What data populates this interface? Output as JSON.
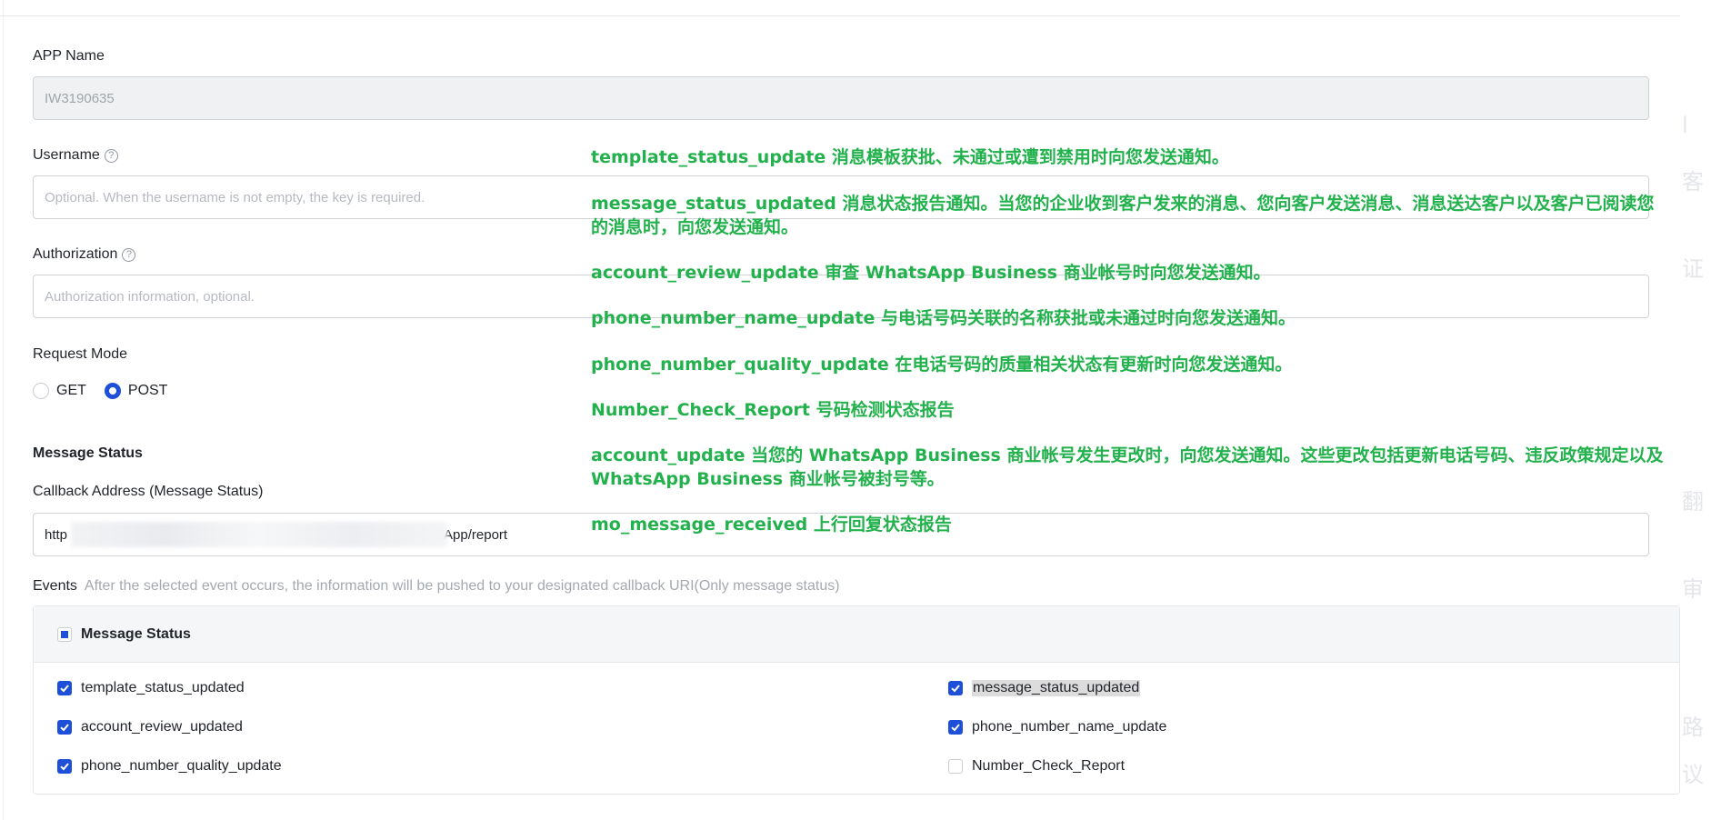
{
  "form": {
    "app_name_label": "APP Name",
    "app_name_value": "IW3190635",
    "username_label": "Username",
    "username_placeholder": "Optional. When the username is not empty, the key is required.",
    "authorization_label": "Authorization",
    "authorization_placeholder": "Authorization information, optional.",
    "request_mode_label": "Request Mode",
    "request_mode_options": [
      {
        "label": "GET",
        "selected": false
      },
      {
        "label": "POST",
        "selected": true
      }
    ],
    "message_status_heading": "Message Status",
    "callback_label": "Callback Address (Message Status)",
    "callback_prefix": "http",
    "callback_suffix": "App/report"
  },
  "events": {
    "label": "Events",
    "hint": "After the selected event occurs, the information will be pushed to your designated callback URI(Only message status)",
    "group_title": "Message Status",
    "items": [
      {
        "label": "template_status_updated",
        "checked": true
      },
      {
        "label": "message_status_updated",
        "checked": true
      },
      {
        "label": "account_review_updated",
        "checked": true
      },
      {
        "label": "phone_number_name_update",
        "checked": true
      },
      {
        "label": "phone_number_quality_update",
        "checked": true
      },
      {
        "label": "Number_Check_Report",
        "checked": false
      }
    ]
  },
  "annotations": [
    "template_status_update 消息模板获批、未通过或遭到禁用时向您发送通知。",
    "message_status_updated 消息状态报告通知。当您的企业收到客户发来的消息、您向客户发送消息、消息送达客户以及客户已阅读您",
    "的消息时，向您发送通知。",
    "account_review_update 审查 WhatsApp Business 商业帐号时向您发送通知。",
    "phone_number_name_update 与电话号码关联的名称获批或未通过时向您发送通知。",
    "phone_number_quality_update 在电话号码的质量相关状态有更新时向您发送通知。",
    "Number_Check_Report 号码检测状态报告",
    "account_update 当您的 WhatsApp Business 商业帐号发生更改时，向您发送通知。这些更改包括更新电话号码、违反政策规定以及",
    "WhatsApp Business 商业帐号被封号等。",
    "mo_message_received 上行回复状态报告"
  ],
  "side_panel_glyphs": [
    "l",
    "客",
    "证",
    "翻",
    "审",
    "路",
    "议"
  ],
  "colors": {
    "accent": "#1e4fd8",
    "annotation": "#22b14c"
  }
}
